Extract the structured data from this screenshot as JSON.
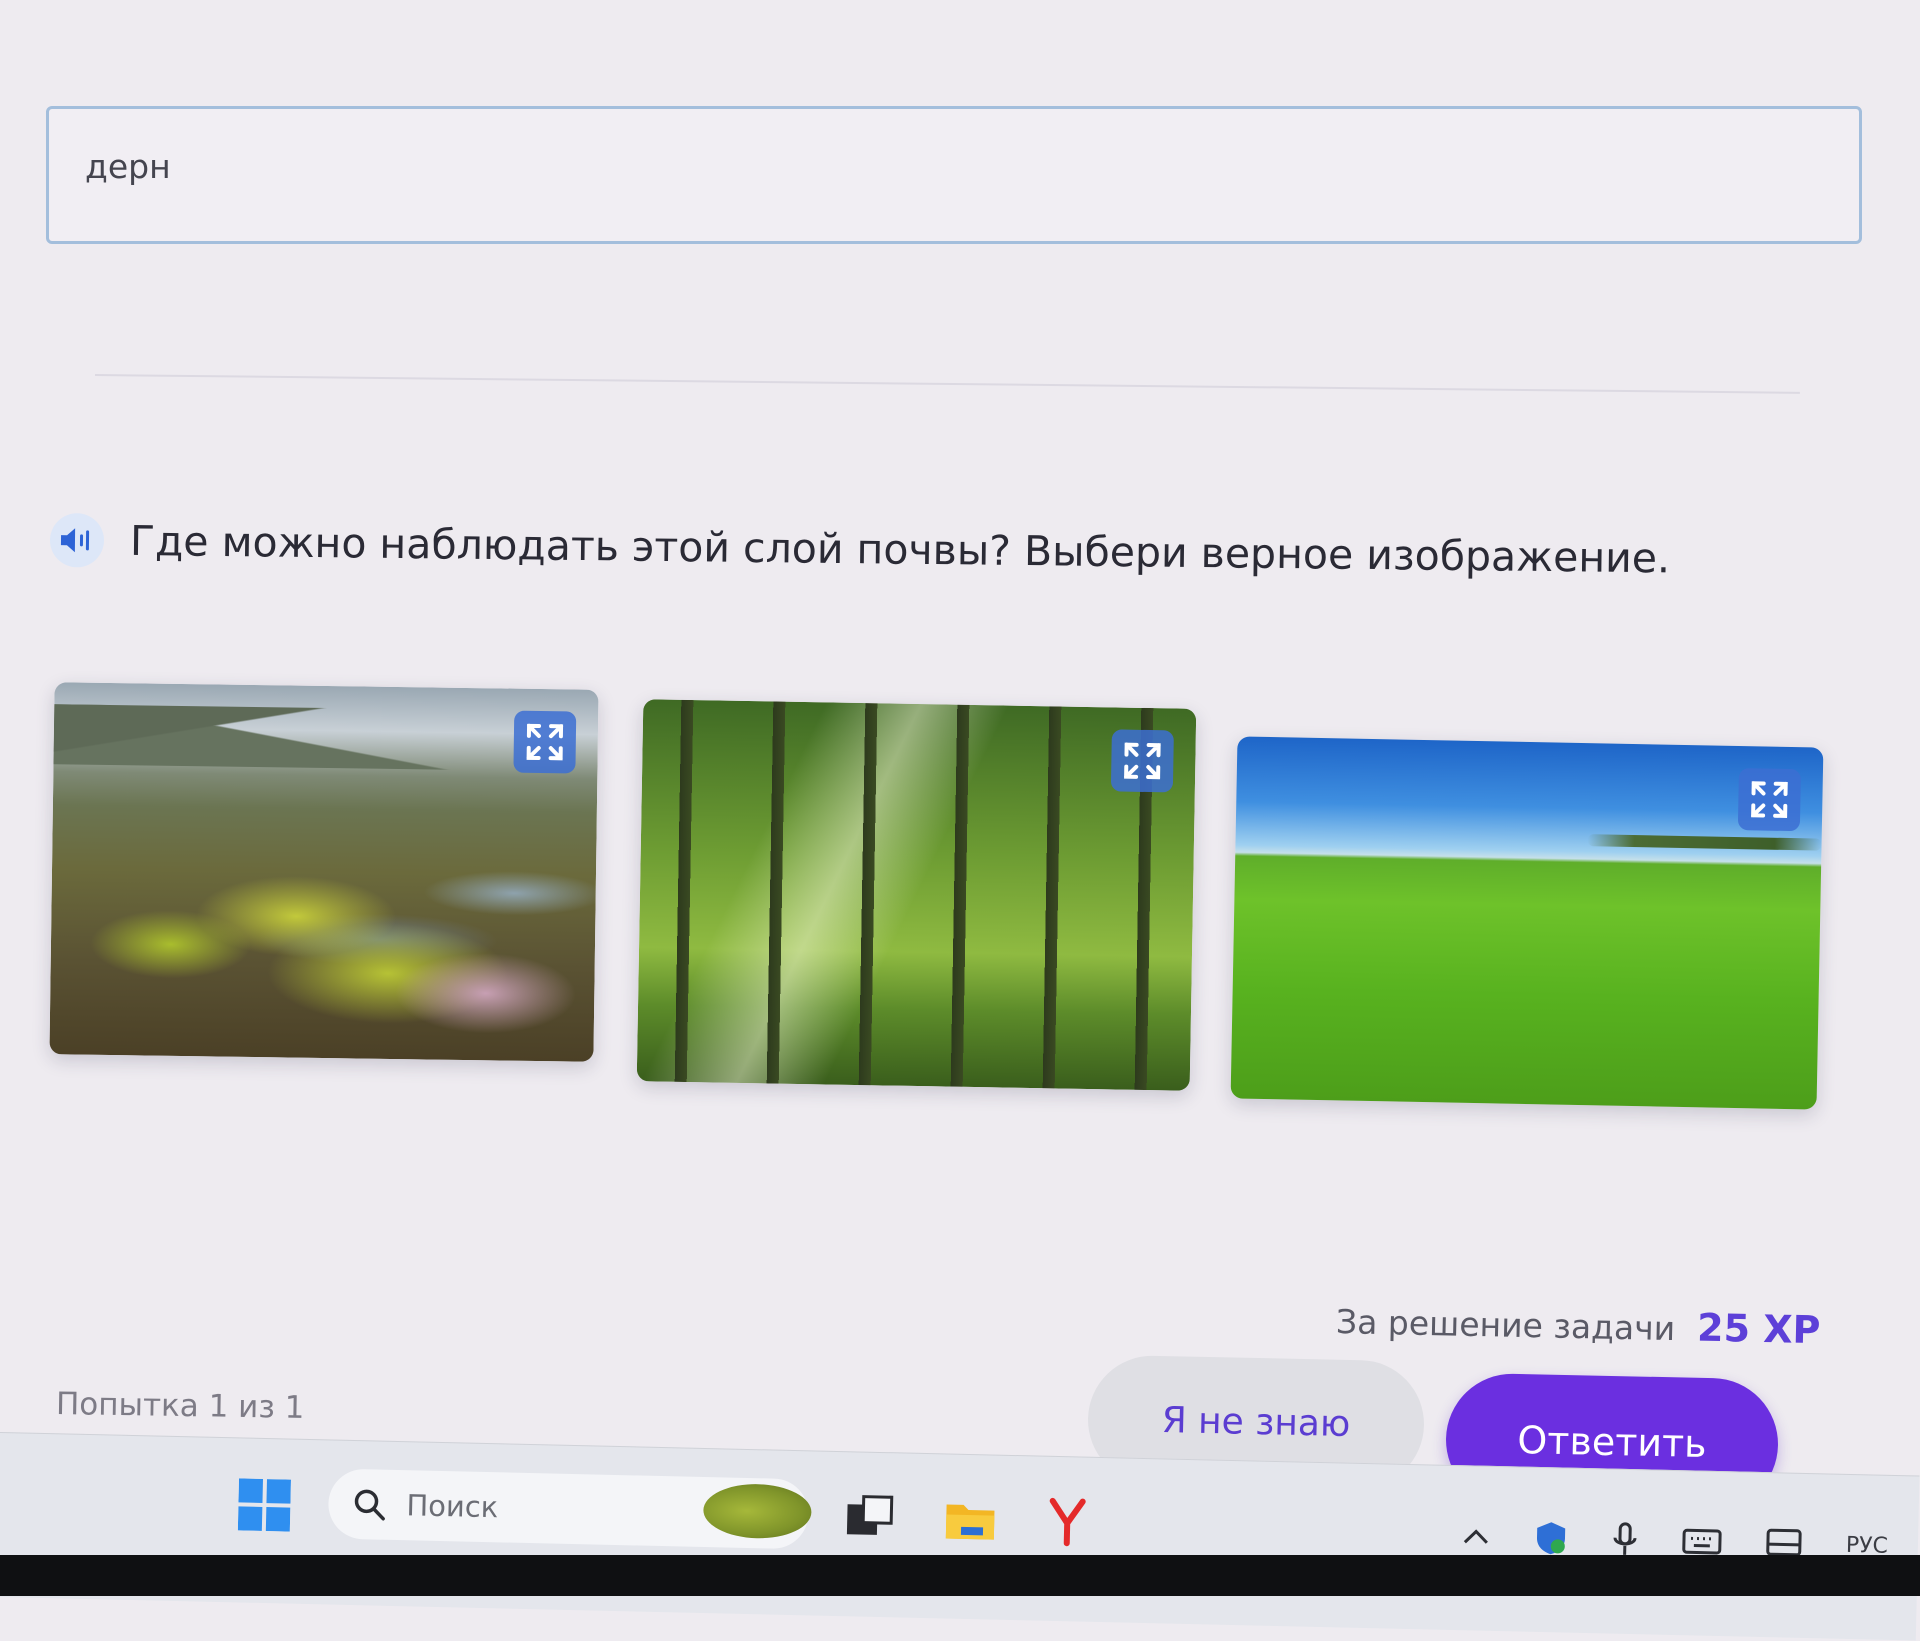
{
  "answer_field": {
    "value": "дерн"
  },
  "question": {
    "text": "Где можно наблюдать этой слой почвы? Выбери верное изображение."
  },
  "image_options": [
    {
      "subject": "tundra bog with mosses and puddles",
      "expand_icon": "expand-icon"
    },
    {
      "subject": "sunlit forest",
      "expand_icon": "expand-icon"
    },
    {
      "subject": "green grass meadow under blue sky",
      "expand_icon": "expand-icon"
    }
  ],
  "reward": {
    "label": "За решение задачи",
    "xp": "25 XP"
  },
  "attempt": {
    "text": "Попытка 1 из 1"
  },
  "buttons": {
    "dont_know": "Я не знаю",
    "answer": "Ответить"
  },
  "taskbar": {
    "search_placeholder": "Поиск",
    "tray_language": "РУС"
  },
  "colors": {
    "accent_purple": "#6b2fe0",
    "xp_purple": "#5d40d8",
    "field_border": "#a3bedc",
    "expand_button": "#3c6ed2"
  }
}
